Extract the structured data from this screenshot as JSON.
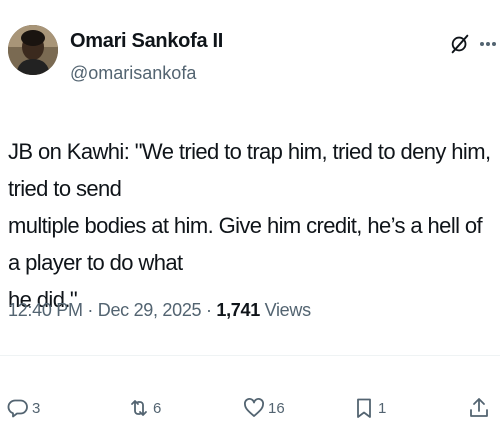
{
  "author": {
    "display_name": "Omari Sankofa II",
    "handle": "@omarisankofa"
  },
  "tweet": {
    "text": "JB on Kawhi: \"We tried to trap him, tried to deny him, tried to send\nmultiple bodies at him. Give him credit, he’s a hell of a player to do what\nhe did.\"",
    "time": "12:40 PM",
    "separator": " · ",
    "date": "Dec 29, 2025",
    "views_count": "1,741",
    "views_label": " Views"
  },
  "actions": {
    "replies": "3",
    "reposts": "6",
    "likes": "16",
    "bookmarks": "1"
  },
  "icons": {
    "header": [
      "grok-icon",
      "more-icon"
    ],
    "actions": [
      "reply-icon",
      "retweet-icon",
      "like-icon",
      "bookmark-icon",
      "share-icon"
    ]
  },
  "colors": {
    "text_primary": "#0f1419",
    "text_secondary": "#536471",
    "divider": "#eff3f4"
  }
}
